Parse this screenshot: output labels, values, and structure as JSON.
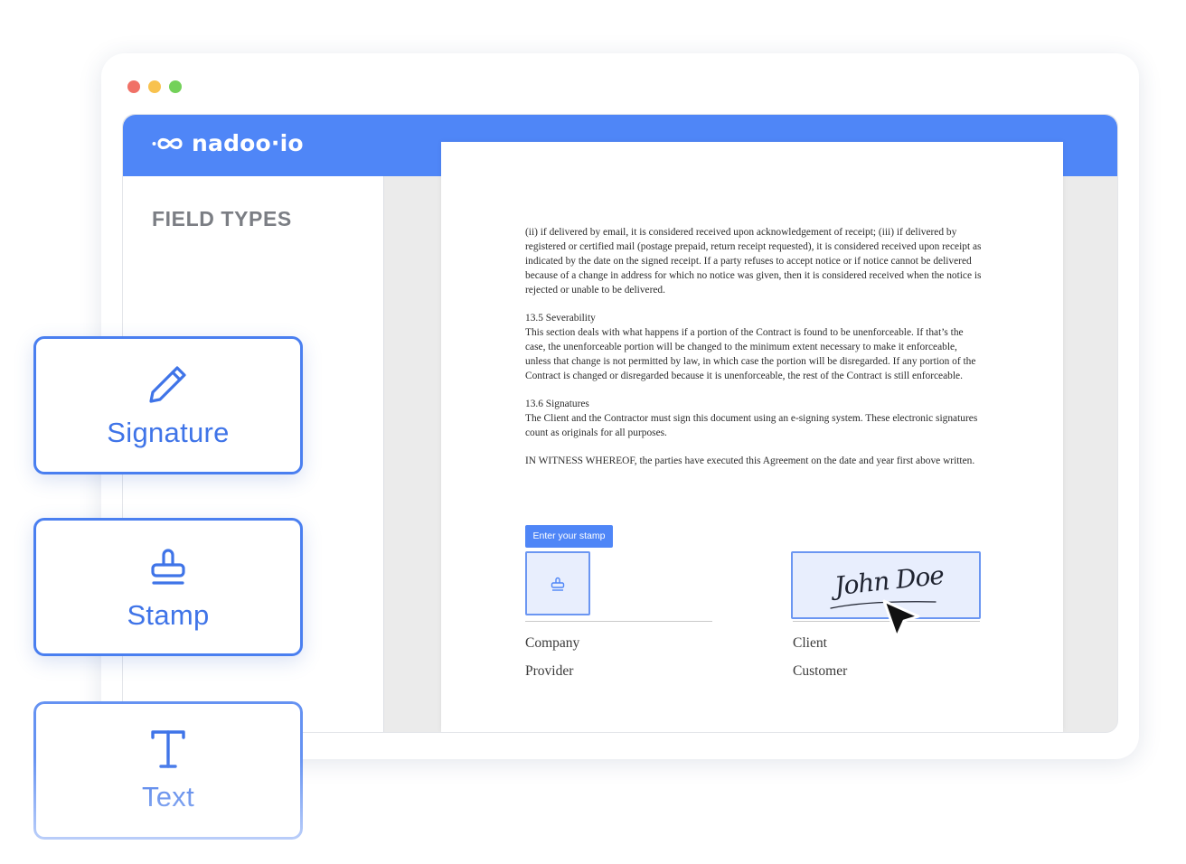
{
  "window": {
    "controls": [
      {
        "name": "close",
        "color": "#f07167"
      },
      {
        "name": "minimize",
        "color": "#f8c24e"
      },
      {
        "name": "maximize",
        "color": "#73d159"
      }
    ]
  },
  "app": {
    "brand": "nadoo·io",
    "accent_color": "#4f86f7"
  },
  "sidebar": {
    "title": "FIELD TYPES"
  },
  "document": {
    "paragraphs": [
      "(ii) if delivered by email, it is considered received upon acknowledgement of receipt; (iii) if delivered by registered or certified mail (postage prepaid, return receipt requested), it is considered received upon receipt as indicated by the date on the signed receipt. If a party refuses to accept notice or if notice cannot be delivered because of a change in address for which no notice was given, then it is considered received when the notice is rejected or unable to be delivered.",
      "13.5 Severability",
      "This section deals with what happens if a portion of the Contract is found to be unenforceable. If that’s the case, the unenforceable portion will be changed to the minimum extent necessary to make it enforceable, unless that change is not permitted by law, in which case the portion will be disregarded. If any portion of the Contract is changed or disregarded because it is unenforceable, the rest of the Contract is still enforceable.",
      "13.6 Signatures",
      "The Client and the Contractor must sign this document using an e-signing system. These electronic signatures count as originals for all purposes.",
      "IN WITNESS WHEREOF, the parties have executed this Agreement on the date and year first above written."
    ],
    "stamp_button_label": "Enter your stamp",
    "signature_text": "John Doe",
    "left_party": {
      "label1": "Company",
      "label2": "Provider"
    },
    "right_party": {
      "label1": "Client",
      "label2": "Customer"
    }
  },
  "field_types": [
    {
      "label": "Signature",
      "icon": "pencil-icon"
    },
    {
      "label": "Stamp",
      "icon": "stamp-icon"
    },
    {
      "label": "Text",
      "icon": "text-icon"
    }
  ]
}
